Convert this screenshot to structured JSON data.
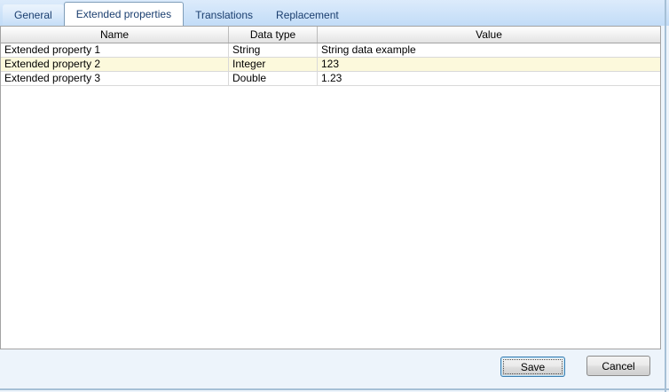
{
  "tabs": [
    {
      "label": "General",
      "active": false
    },
    {
      "label": "Extended properties",
      "active": true
    },
    {
      "label": "Translations",
      "active": false
    },
    {
      "label": "Replacement",
      "active": false
    }
  ],
  "table": {
    "columns": [
      "Name",
      "Data type",
      "Value"
    ],
    "rows": [
      {
        "name": "Extended property 1",
        "data_type": "String",
        "value": "String data example",
        "highlighted": false
      },
      {
        "name": "Extended property 2",
        "data_type": "Integer",
        "value": "123",
        "highlighted": true
      },
      {
        "name": "Extended property 3",
        "data_type": "Double",
        "value": "1.23",
        "highlighted": false
      }
    ]
  },
  "buttons": {
    "save": "Save",
    "cancel": "Cancel"
  },
  "colors": {
    "tab_strip_bg": "#c2dcf7",
    "tab_text": "#1a3e6f",
    "active_tab_bg": "#ffffff",
    "row_highlight_bg": "#fcf9dc",
    "footer_bg": "#edf4fb",
    "focused_button_border": "#3c7fb1",
    "grid_border": "#a3a3a3",
    "row_border": "#d9d9d9"
  }
}
